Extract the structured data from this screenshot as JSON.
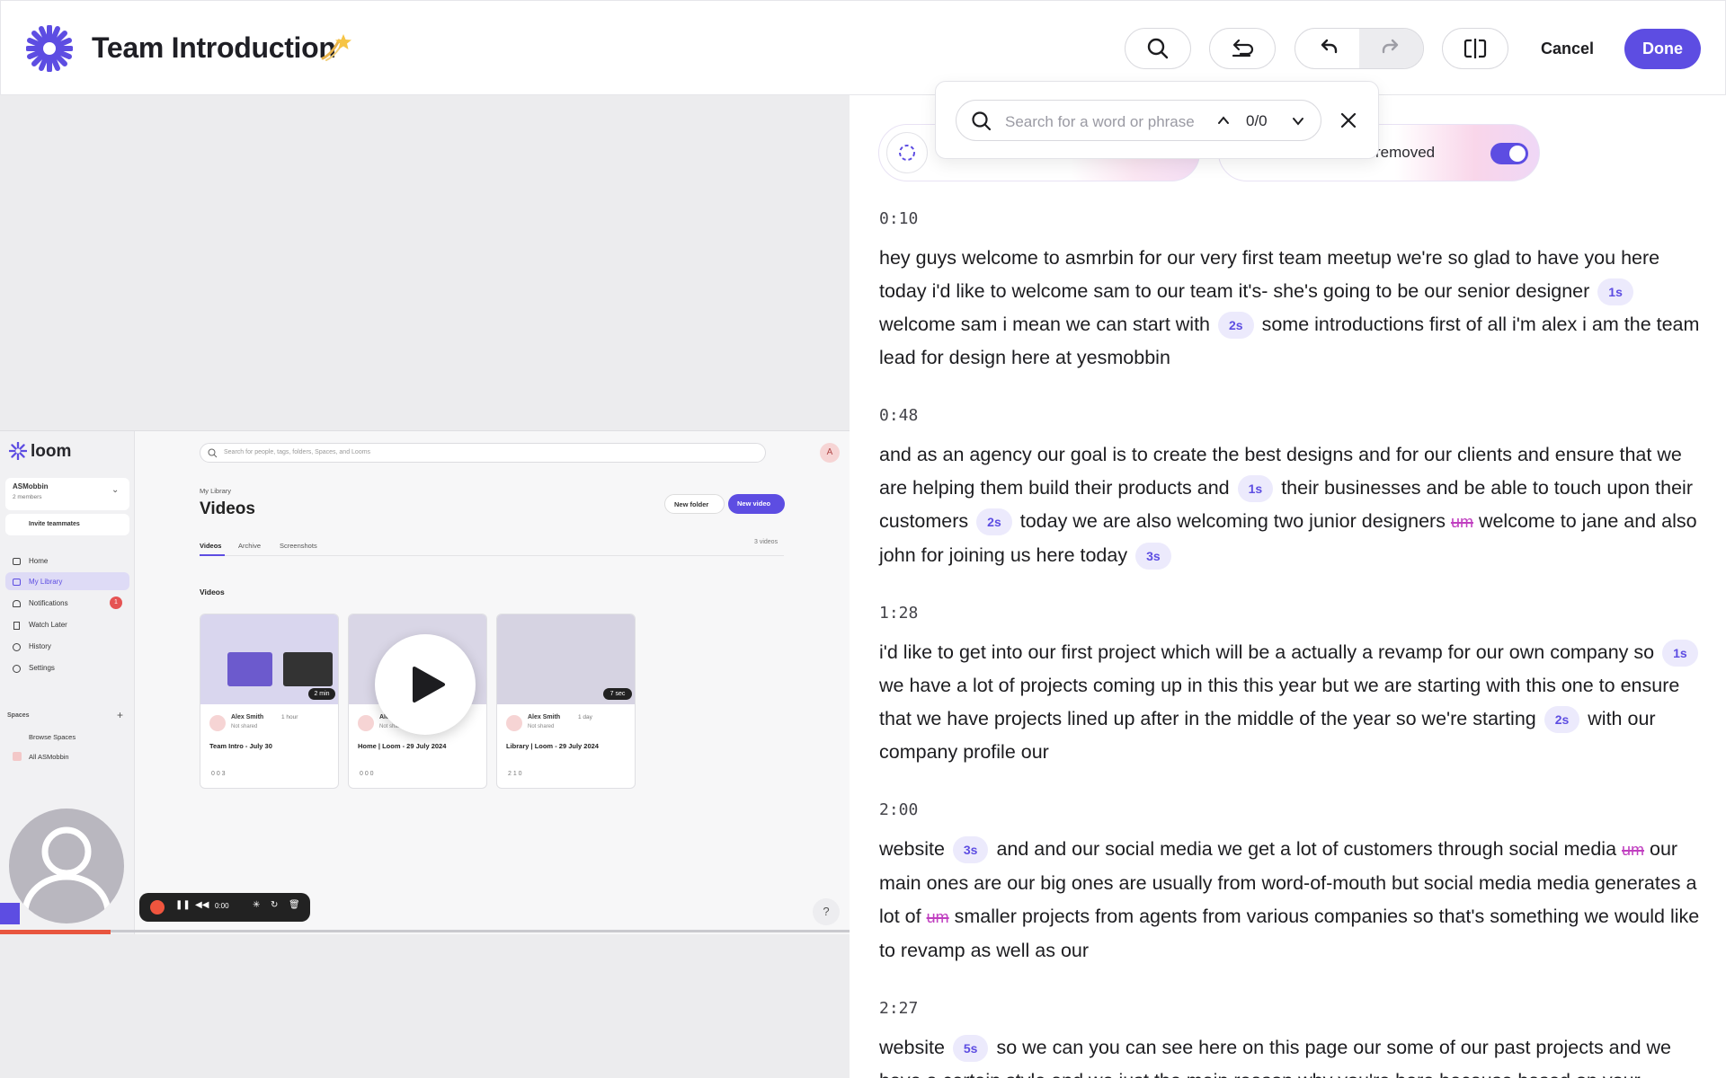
{
  "header": {
    "title": "Team Introduction",
    "cancel_label": "Cancel",
    "done_label": "Done"
  },
  "colors": {
    "accent": "#5d4de2",
    "filler": "#c03fc0",
    "gap_bg": "#eceafc"
  },
  "search": {
    "placeholder": "Search for a word or phrase",
    "count": "0/0"
  },
  "pills": {
    "filler_label": "removed"
  },
  "video": {
    "brand": "loom",
    "search_placeholder": "Search for people, tags, folders, Spaces, and Looms",
    "workspace": "ASMobbin",
    "members": "2 members",
    "invite": "Invite teammates",
    "nav": [
      "Home",
      "My Library",
      "Notifications",
      "Watch Later",
      "History",
      "Settings"
    ],
    "notif_count": "1",
    "spaces_label": "Spaces",
    "spaces": [
      "Browse Spaces",
      "All ASMobbin"
    ],
    "crumb": "My Library",
    "page_title": "Videos",
    "new_folder": "New folder",
    "new_video": "New video",
    "tabs": [
      "Videos",
      "Archive",
      "Screenshots"
    ],
    "count_label": "3 videos",
    "section_label": "Videos",
    "cards": [
      {
        "author": "Alex Smith",
        "time": "1 hour",
        "shared": "Not shared",
        "title": "Team Intro - July 30",
        "duration": "2 min",
        "stats": "0  0  3"
      },
      {
        "author": "Alex Smith",
        "time": "",
        "shared": "Not shared",
        "title": "Home | Loom - 29 July 2024",
        "duration": "",
        "stats": "0  0  0"
      },
      {
        "author": "Alex Smith",
        "time": "1 day",
        "shared": "Not shared",
        "title": "Library | Loom - 29 July 2024",
        "duration": "7 sec",
        "stats": "2  1  0"
      }
    ],
    "rec_time": "0:00",
    "help": "?",
    "progress": 0.13
  },
  "transcript": [
    {
      "time": "0:10",
      "parts": [
        {
          "t": "text",
          "v": "hey guys welcome to asmrbin for our very first team meetup we're so glad to have you here today i'd like to welcome sam to our team it's- she's going to be our senior designer"
        },
        {
          "t": "gap",
          "v": "1s"
        },
        {
          "t": "text",
          "v": "welcome sam i mean we can start with"
        },
        {
          "t": "gap",
          "v": "2s"
        },
        {
          "t": "text",
          "v": "some introductions first of all i'm alex i am the team lead for design here at yesmobbin"
        }
      ]
    },
    {
      "time": "0:48",
      "parts": [
        {
          "t": "text",
          "v": "and as an agency our goal is to create the best designs and for our clients and ensure that we are helping them build their products and"
        },
        {
          "t": "gap",
          "v": "1s"
        },
        {
          "t": "text",
          "v": "their businesses and be able to touch upon their customers"
        },
        {
          "t": "gap",
          "v": "2s"
        },
        {
          "t": "text",
          "v": "today we are also welcoming two junior designers"
        },
        {
          "t": "filler",
          "v": "um"
        },
        {
          "t": "text",
          "v": "welcome to jane and also john for joining us here today"
        },
        {
          "t": "gap",
          "v": "3s"
        }
      ]
    },
    {
      "time": "1:28",
      "parts": [
        {
          "t": "text",
          "v": "i'd like to get into our first project which will be a actually a revamp for our own company so"
        },
        {
          "t": "gap",
          "v": "1s"
        },
        {
          "t": "text",
          "v": "we have a lot of projects coming up in this this year but we are starting with this one to ensure that we have projects lined up after in the middle of the year so we're starting"
        },
        {
          "t": "gap",
          "v": "2s"
        },
        {
          "t": "text",
          "v": "with our company profile our"
        }
      ]
    },
    {
      "time": "2:00",
      "parts": [
        {
          "t": "text",
          "v": "website"
        },
        {
          "t": "gap",
          "v": "3s"
        },
        {
          "t": "text",
          "v": "and and our social media we get a lot of customers through social media"
        },
        {
          "t": "filler",
          "v": "um"
        },
        {
          "t": "text",
          "v": "our main ones are our big ones are usually from word-of-mouth but social media media generates a lot of"
        },
        {
          "t": "filler",
          "v": "um"
        },
        {
          "t": "text",
          "v": "smaller projects from agents from various companies so that's something we would like to revamp as well as our"
        }
      ]
    },
    {
      "time": "2:27",
      "parts": [
        {
          "t": "text",
          "v": "website"
        },
        {
          "t": "gap",
          "v": "5s"
        },
        {
          "t": "text",
          "v": "so we can you can see here on this page our some of our past projects and we have a certain style and we just the main reason why you're here because based on your"
        }
      ]
    }
  ]
}
